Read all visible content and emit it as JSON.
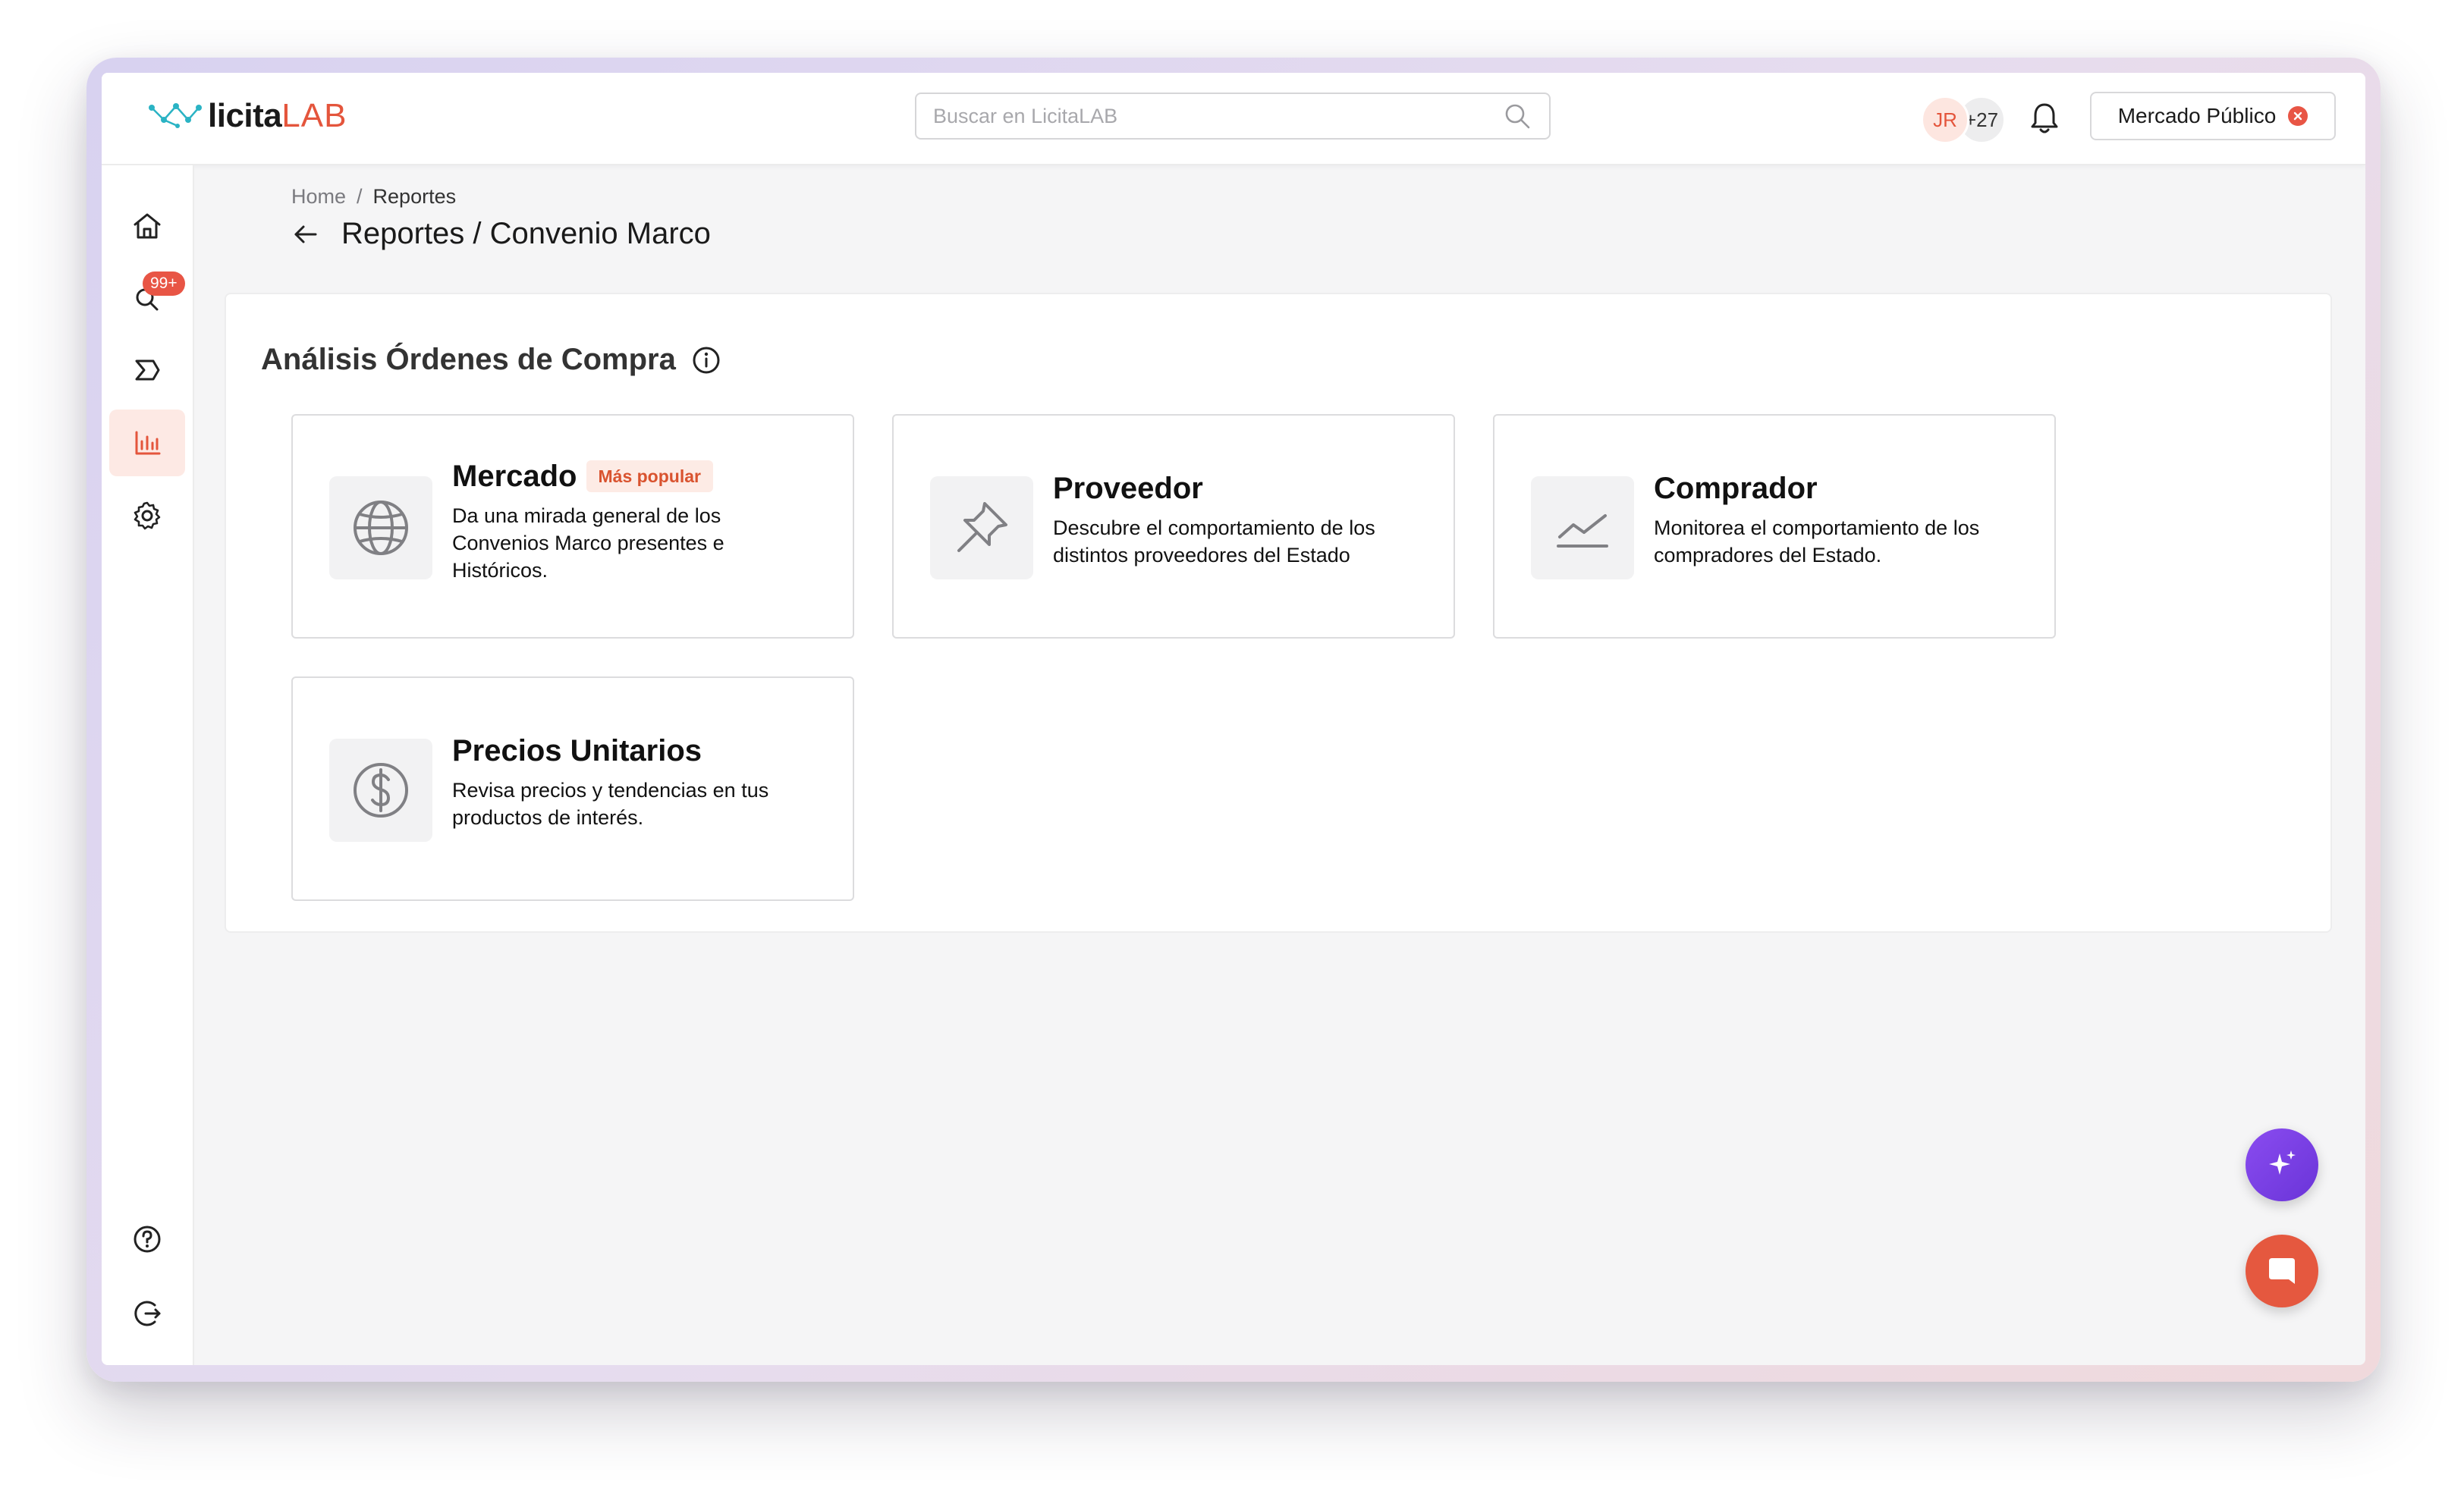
{
  "brand": {
    "logo_main": "licita",
    "logo_accent": "LAB"
  },
  "header": {
    "search_placeholder": "Buscar en LicitaLAB",
    "avatar_initials": "JR",
    "avatar_more": "+27",
    "market_button_label": "Mercado Público"
  },
  "sidebar": {
    "items": [
      {
        "name": "home",
        "icon": "home-icon"
      },
      {
        "name": "search",
        "icon": "search-icon",
        "badge": "99+"
      },
      {
        "name": "sigma",
        "icon": "sigma-icon"
      },
      {
        "name": "reports",
        "icon": "bar-chart-icon",
        "active": true
      },
      {
        "name": "settings",
        "icon": "gear-icon"
      },
      {
        "name": "help",
        "icon": "help-icon"
      },
      {
        "name": "logout",
        "icon": "logout-icon"
      }
    ]
  },
  "breadcrumb": {
    "home": "Home",
    "separator": "/",
    "current": "Reportes"
  },
  "page": {
    "title": "Reportes / Convenio Marco"
  },
  "section": {
    "title": "Análisis Órdenes de Compra"
  },
  "cards": [
    {
      "title": "Mercado",
      "badge": "Más popular",
      "description": "Da una mirada general de los Convenios Marco presentes e Históricos.",
      "icon": "globe-icon"
    },
    {
      "title": "Proveedor",
      "description": "Descubre el comportamiento de los distintos proveedores del Estado",
      "icon": "pin-icon"
    },
    {
      "title": "Comprador",
      "description": "Monitorea el comportamiento de los compradores del Estado.",
      "icon": "trend-line-icon"
    },
    {
      "title": "Precios Unitarios",
      "description": "Revisa precios y tendencias en tus productos de interés.",
      "icon": "dollar-icon"
    }
  ],
  "colors": {
    "accent": "#e4553c",
    "badge_red": "#e85545",
    "ai_purple": "#7b3fe4",
    "chat_orange": "#e5583f"
  }
}
